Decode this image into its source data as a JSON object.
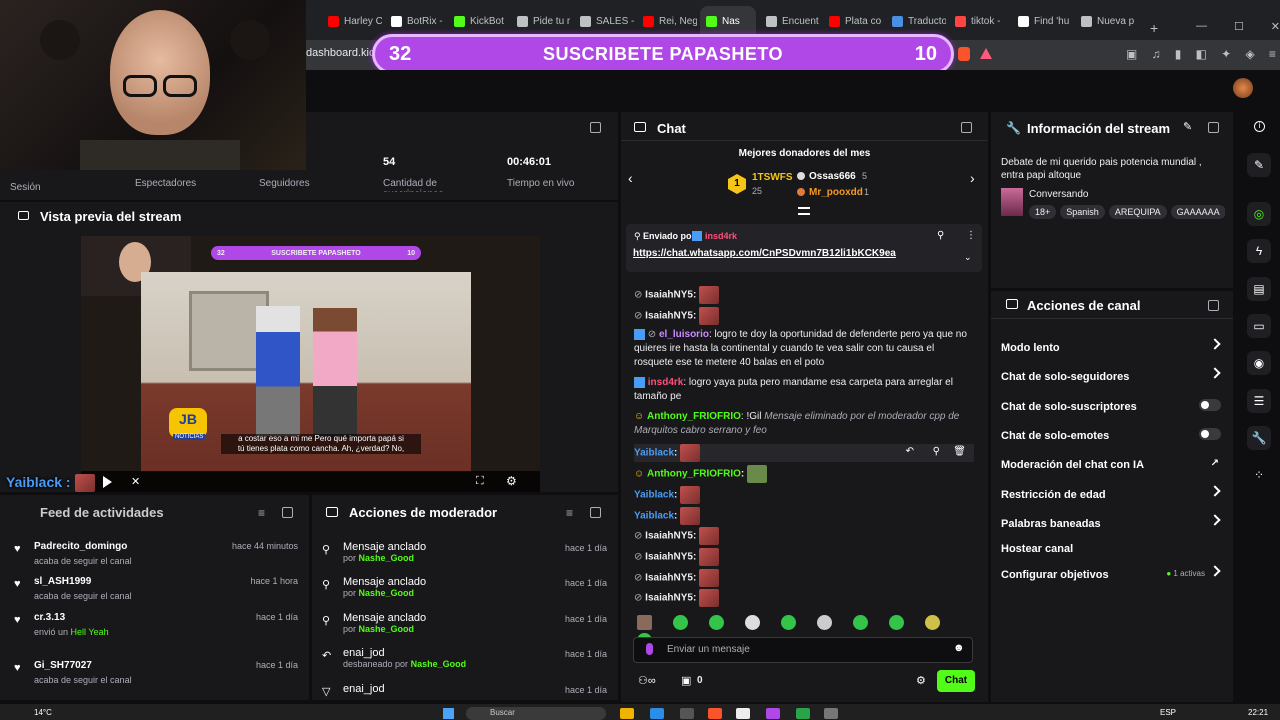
{
  "browser": {
    "tabs": [
      {
        "label": "Harley C",
        "color": "#ff0000"
      },
      {
        "label": "BotRix -",
        "color": "#ffffff"
      },
      {
        "label": "KickBot",
        "color": "#53fc18"
      },
      {
        "label": "Pide tu r",
        "color": "#bdc1c6"
      },
      {
        "label": "SALES -",
        "color": "#bdc1c6"
      },
      {
        "label": "Rei, Neg",
        "color": "#ff0000"
      },
      {
        "label": "Nas",
        "color": "#53fc18",
        "active": true
      },
      {
        "label": "Encuent",
        "color": "#bdc1c6"
      },
      {
        "label": "Plata co",
        "color": "#ff0000"
      },
      {
        "label": "Traducto",
        "color": "#4a90e2"
      },
      {
        "label": "tiktok -",
        "color": "#ff4444"
      },
      {
        "label": "Find 'hu",
        "color": "#ffffff"
      },
      {
        "label": "Nueva p",
        "color": "#bdc1c6"
      }
    ],
    "new_tab": "+",
    "window_controls": [
      "—",
      "☐",
      "✕"
    ],
    "url": "dashboard.kick."
  },
  "banner": {
    "left_number": "32",
    "text": "SUSCRIBETE PAPASHETO",
    "right_number": "10"
  },
  "stats": {
    "session": "Sesión",
    "viewers": "Espectadores",
    "followers": "Seguidores",
    "subs_value": "54",
    "subs_label": "Cantidad de suscripciones",
    "live_value": "00:46:01",
    "live_label": "Tiempo en vivo"
  },
  "preview": {
    "title": "Vista previa del stream",
    "mini_banner_left": "32",
    "mini_banner_text": "SUSCRIBETE PAPASHETO",
    "mini_banner_right": "10",
    "logo_text": "JB",
    "logo_sub": "NOTICIAS",
    "subtitle_1": "a costar eso a mi me Pero qué importa papá si",
    "subtitle_2": "tú tienes plata como cancha. Ah, ¿verdad? No,"
  },
  "overlay_chat": [
    {
      "name": "Yaiblack",
      "color": "#4a9df7"
    },
    {
      "name": "Anthony_FRIOFRIO",
      "color": "#53fc18"
    },
    {
      "name": "Yaiblack",
      "color": "#4a9df7"
    },
    {
      "name": "Yaiblack",
      "color": "#4a9df7"
    },
    {
      "name": "IsaiahNY5",
      "color": "#ffffff"
    },
    {
      "name": "IsaiahNY5",
      "color": "#ffffff"
    },
    {
      "name": "IsaiahNY5",
      "color": "#ffffff"
    },
    {
      "name": "IsaiahNY5",
      "color": "#ffffff"
    }
  ],
  "feed": {
    "title": "Feed de actividades",
    "items": [
      {
        "user": "Padrecito_domingo",
        "action": "acaba de seguir el canal",
        "time": "hace 44 minutos"
      },
      {
        "user": "sl_ASH1999",
        "action": "acaba de seguir el canal",
        "time": "hace 1 hora"
      },
      {
        "user": "cr.3.13",
        "action": "envió un",
        "extra": "Hell Yeah",
        "time": "hace 1 día"
      },
      {
        "user": "Gi_SH77027",
        "action": "acaba de seguir el canal",
        "time": "hace 1 día"
      }
    ]
  },
  "mod_actions": {
    "title": "Acciones de moderador",
    "items": [
      {
        "title": "Mensaje anclado",
        "by_prefix": "por",
        "by": "Nashe_Good",
        "time": "hace 1 día",
        "icon": "pin"
      },
      {
        "title": "Mensaje anclado",
        "by_prefix": "por",
        "by": "Nashe_Good",
        "time": "hace 1 día",
        "icon": "pin"
      },
      {
        "title": "Mensaje anclado",
        "by_prefix": "por",
        "by": "Nashe_Good",
        "time": "hace 1 día",
        "icon": "pin"
      },
      {
        "title": "enai_jod",
        "by_prefix": "desbaneado por",
        "by": "Nashe_Good",
        "time": "hace 1 día",
        "icon": "undo"
      },
      {
        "title": "enai_jod",
        "by_prefix": "",
        "by": "",
        "time": "hace 1 día",
        "icon": "filter"
      }
    ]
  },
  "chat": {
    "title": "Chat",
    "donors_title": "Mejores donadores del mes",
    "donors": [
      {
        "rank": "1",
        "name": "1TSWFS",
        "amount": "25"
      },
      {
        "rank": "2",
        "name": "Ossas666",
        "amount": "5"
      },
      {
        "rank": "3",
        "name": "Mr_pooxdd",
        "amount": "1"
      }
    ],
    "pinned": {
      "label": "Enviado por",
      "user": "insd4rk",
      "link": "https://chat.whatsapp.com/CnPSDvmn7B12li1bKCK9ea"
    },
    "messages": [
      {
        "user": "IsaiahNY5",
        "text": ""
      },
      {
        "user": "IsaiahNY5",
        "text": ""
      },
      {
        "user": "el_luisorio",
        "text": "logro te doy la oportunidad de defenderte pero ya que no quieres ire hasta la continental y cuando te vea salir con tu causa el rosquete ese te metere 40 balas en el poto"
      },
      {
        "user": "insd4rk",
        "text": "logro yaya puta pero mandame esa carpeta para arreglar el tamaño pe"
      },
      {
        "user": "Anthony_FRIOFRIO",
        "text": "!Gil",
        "deleted": "Mensaje eliminado por el moderador cpp de Marquitos cabro serrano y feo"
      },
      {
        "user": "Yaiblack",
        "text": ""
      },
      {
        "user": "Anthony_FRIOFRIO",
        "text": ""
      },
      {
        "user": "Yaiblack",
        "text": ""
      },
      {
        "user": "Yaiblack",
        "text": ""
      },
      {
        "user": "IsaiahNY5",
        "text": ""
      },
      {
        "user": "IsaiahNY5",
        "text": ""
      },
      {
        "user": "IsaiahNY5",
        "text": ""
      },
      {
        "user": "IsaiahNY5",
        "text": ""
      }
    ],
    "input_placeholder": "Enviar un mensaje",
    "points": "0",
    "send_label": "Chat"
  },
  "stream_info": {
    "title": "Información del stream",
    "description": "Debate de mi querido pais potencia mundial , entra papi altoque",
    "category": "Conversando",
    "tags": [
      "18+",
      "Spanish",
      "AREQUIPA",
      "GAAAAAA"
    ]
  },
  "channel_actions": {
    "title": "Acciones de canal",
    "rows": [
      {
        "label": "Modo lento",
        "control": "chevron"
      },
      {
        "label": "Chat de solo-seguidores",
        "control": "chevron"
      },
      {
        "label": "Chat de solo-suscriptores",
        "control": "toggle"
      },
      {
        "label": "Chat de solo-emotes",
        "control": "toggle"
      },
      {
        "label": "Moderación del chat con IA",
        "control": "external"
      },
      {
        "label": "Restricción de edad",
        "control": "chevron"
      },
      {
        "label": "Palabras baneadas",
        "control": "chevron"
      },
      {
        "label": "Hostear canal",
        "control": "none"
      },
      {
        "label": "Configurar objetivos",
        "control": "chevron",
        "extra": "1 activas"
      }
    ]
  },
  "taskbar": {
    "weather": "14°C",
    "search": "Buscar",
    "lang": "ESP",
    "time": "22:21"
  }
}
